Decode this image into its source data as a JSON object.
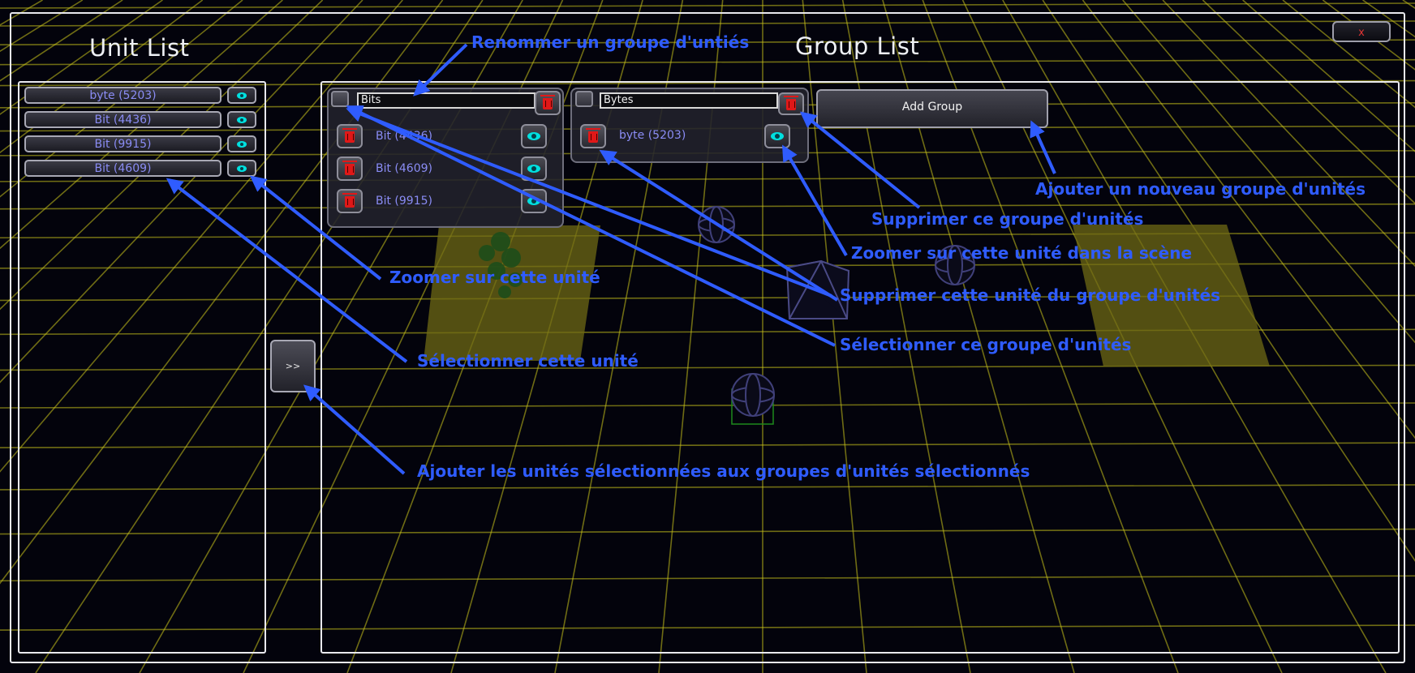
{
  "window": {
    "close_label": "x"
  },
  "unit_list": {
    "title": "Unit List",
    "units": [
      {
        "label": "byte (5203)"
      },
      {
        "label": "Bit (4436)"
      },
      {
        "label": "Bit (9915)"
      },
      {
        "label": "Bit (4609)"
      }
    ],
    "add_to_group_label": ">>"
  },
  "group_list": {
    "title": "Group List",
    "add_group_label": "Add Group",
    "groups": [
      {
        "name": "Bits",
        "members": [
          {
            "label": "Bit (4436)"
          },
          {
            "label": "Bit (4609)"
          },
          {
            "label": "Bit (9915)"
          }
        ]
      },
      {
        "name": "Bytes",
        "members": [
          {
            "label": "byte (5203)"
          }
        ]
      }
    ]
  },
  "annotations": {
    "rename_group": "Renommer un groupe d'untiés",
    "add_group": "Ajouter un nouveau groupe d'unités",
    "delete_group": "Supprimer ce groupe d'unités",
    "zoom_unit_scene": "Zoomer sur cette unité dans la scène",
    "zoom_unit": "Zoomer sur cette unité",
    "remove_unit_from_group": "Supprimer cette unité du groupe d'unités",
    "select_group": "Sélectionner ce groupe d'unités",
    "select_unit": "Sélectionner cette unité",
    "add_selected_units": "Ajouter les unités sélectionnées aux groupes d'unités sélectionnés"
  },
  "colors": {
    "annotation": "#2f5cff",
    "grid": "#c8c21c",
    "unit_label": "#8a8cf4",
    "eye_icon": "#00e0e0",
    "trash_icon": "#e01818"
  }
}
